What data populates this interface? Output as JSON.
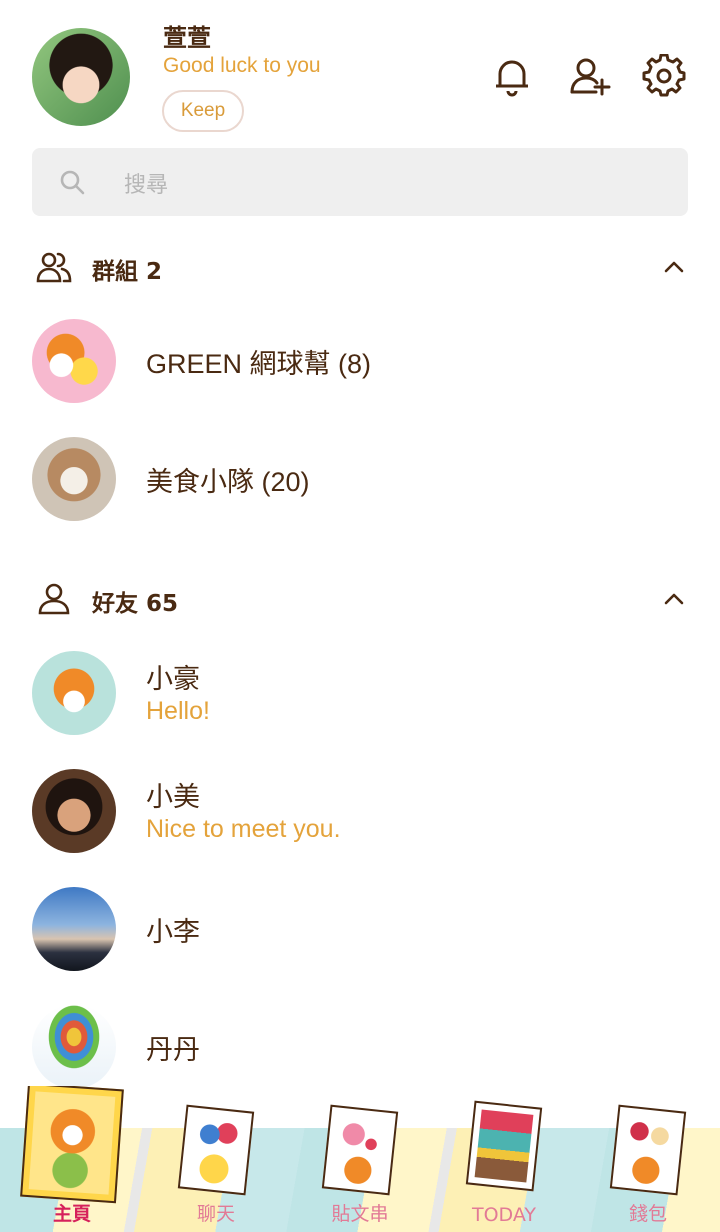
{
  "profile": {
    "name": "萱萱",
    "status_message": "Good luck to you",
    "keep_label": "Keep"
  },
  "header_icons": {
    "notifications": "bell-icon",
    "add_friend": "add-friend-icon",
    "settings": "gear-icon"
  },
  "search": {
    "placeholder": "搜尋"
  },
  "groups": {
    "label": "群組 2",
    "items": [
      {
        "name": "GREEN 網球幫 (8)"
      },
      {
        "name": "美食小隊 (20)"
      }
    ]
  },
  "friends": {
    "label": "好友 65",
    "items": [
      {
        "name": "小豪",
        "message": "Hello!"
      },
      {
        "name": "小美",
        "message": "Nice to meet you."
      },
      {
        "name": "小李"
      },
      {
        "name": "丹丹"
      }
    ]
  },
  "tabbar": {
    "tabs": [
      {
        "label": "主頁",
        "active": true
      },
      {
        "label": "聊天"
      },
      {
        "label": "貼文串"
      },
      {
        "label": "TODAY"
      },
      {
        "label": "錢包"
      }
    ]
  },
  "colors": {
    "text_dark": "#4a2a12",
    "accent_orange": "#e4a33b",
    "tab_active": "#d6215b",
    "tab_inactive": "#e27a96"
  }
}
